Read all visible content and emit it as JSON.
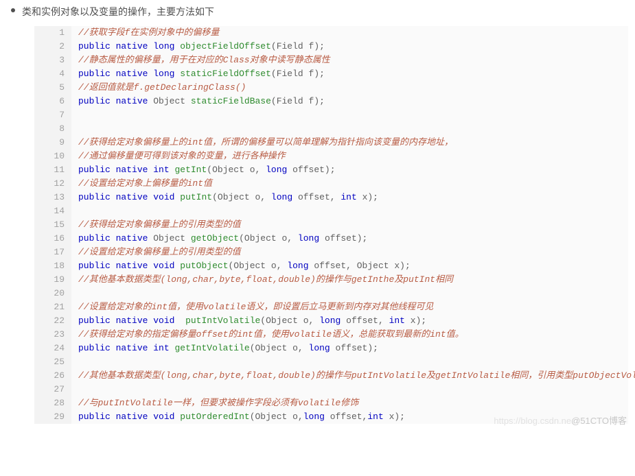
{
  "intro_text": "类和实例对象以及变量的操作，主要方法如下",
  "watermark_left": "https://blog.csdn.ne",
  "watermark_right": "@51CTO博客",
  "code_lines": [
    [
      {
        "t": "//获取字段f在实例对象中的偏移量",
        "c": "comment"
      }
    ],
    [
      {
        "t": "public",
        "c": "keyword"
      },
      {
        "t": " "
      },
      {
        "t": "native",
        "c": "keyword"
      },
      {
        "t": " "
      },
      {
        "t": "long",
        "c": "keyword"
      },
      {
        "t": " "
      },
      {
        "t": "objectFieldOffset",
        "c": "method"
      },
      {
        "t": "(Field f);",
        "c": "ident"
      }
    ],
    [
      {
        "t": "//静态属性的偏移量，用于在对应的Class对象中读写静态属性",
        "c": "comment"
      }
    ],
    [
      {
        "t": "public",
        "c": "keyword"
      },
      {
        "t": " "
      },
      {
        "t": "native",
        "c": "keyword"
      },
      {
        "t": " "
      },
      {
        "t": "long",
        "c": "keyword"
      },
      {
        "t": " "
      },
      {
        "t": "staticFieldOffset",
        "c": "method"
      },
      {
        "t": "(Field f);",
        "c": "ident"
      }
    ],
    [
      {
        "t": "//返回值就是f.getDeclaringClass()",
        "c": "comment"
      }
    ],
    [
      {
        "t": "public",
        "c": "keyword"
      },
      {
        "t": " "
      },
      {
        "t": "native",
        "c": "keyword"
      },
      {
        "t": " "
      },
      {
        "t": "Object",
        "c": "type"
      },
      {
        "t": " "
      },
      {
        "t": "staticFieldBase",
        "c": "method"
      },
      {
        "t": "(Field f);",
        "c": "ident"
      }
    ],
    [],
    [],
    [
      {
        "t": "//获得给定对象偏移量上的int值，所谓的偏移量可以简单理解为指针指向该变量的内存地址，",
        "c": "comment"
      }
    ],
    [
      {
        "t": "//通过偏移量便可得到该对象的变量，进行各种操作",
        "c": "comment"
      }
    ],
    [
      {
        "t": "public",
        "c": "keyword"
      },
      {
        "t": " "
      },
      {
        "t": "native",
        "c": "keyword"
      },
      {
        "t": " "
      },
      {
        "t": "int",
        "c": "keyword"
      },
      {
        "t": " "
      },
      {
        "t": "getInt",
        "c": "method"
      },
      {
        "t": "(Object o, ",
        "c": "ident"
      },
      {
        "t": "long",
        "c": "keyword"
      },
      {
        "t": " offset);",
        "c": "ident"
      }
    ],
    [
      {
        "t": "//设置给定对象上偏移量的int值",
        "c": "comment"
      }
    ],
    [
      {
        "t": "public",
        "c": "keyword"
      },
      {
        "t": " "
      },
      {
        "t": "native",
        "c": "keyword"
      },
      {
        "t": " "
      },
      {
        "t": "void",
        "c": "keyword"
      },
      {
        "t": " "
      },
      {
        "t": "putInt",
        "c": "method"
      },
      {
        "t": "(Object o, ",
        "c": "ident"
      },
      {
        "t": "long",
        "c": "keyword"
      },
      {
        "t": " offset, ",
        "c": "ident"
      },
      {
        "t": "int",
        "c": "keyword"
      },
      {
        "t": " x);",
        "c": "ident"
      }
    ],
    [],
    [
      {
        "t": "//获得给定对象偏移量上的引用类型的值",
        "c": "comment"
      }
    ],
    [
      {
        "t": "public",
        "c": "keyword"
      },
      {
        "t": " "
      },
      {
        "t": "native",
        "c": "keyword"
      },
      {
        "t": " "
      },
      {
        "t": "Object",
        "c": "type"
      },
      {
        "t": " "
      },
      {
        "t": "getObject",
        "c": "method"
      },
      {
        "t": "(Object o, ",
        "c": "ident"
      },
      {
        "t": "long",
        "c": "keyword"
      },
      {
        "t": " offset);",
        "c": "ident"
      }
    ],
    [
      {
        "t": "//设置给定对象偏移量上的引用类型的值",
        "c": "comment"
      }
    ],
    [
      {
        "t": "public",
        "c": "keyword"
      },
      {
        "t": " "
      },
      {
        "t": "native",
        "c": "keyword"
      },
      {
        "t": " "
      },
      {
        "t": "void",
        "c": "keyword"
      },
      {
        "t": " "
      },
      {
        "t": "putObject",
        "c": "method"
      },
      {
        "t": "(Object o, ",
        "c": "ident"
      },
      {
        "t": "long",
        "c": "keyword"
      },
      {
        "t": " offset, Object x);",
        "c": "ident"
      }
    ],
    [
      {
        "t": "//其他基本数据类型(long,char,byte,float,double)的操作与getInthe及putInt相同",
        "c": "comment"
      }
    ],
    [],
    [
      {
        "t": "//设置给定对象的int值，使用volatile语义，即设置后立马更新到内存对其他线程可见",
        "c": "comment"
      }
    ],
    [
      {
        "t": "public",
        "c": "keyword"
      },
      {
        "t": " "
      },
      {
        "t": "native",
        "c": "keyword"
      },
      {
        "t": " "
      },
      {
        "t": "void",
        "c": "keyword"
      },
      {
        "t": "  "
      },
      {
        "t": "putIntVolatile",
        "c": "method"
      },
      {
        "t": "(Object o, ",
        "c": "ident"
      },
      {
        "t": "long",
        "c": "keyword"
      },
      {
        "t": " offset, ",
        "c": "ident"
      },
      {
        "t": "int",
        "c": "keyword"
      },
      {
        "t": " x);",
        "c": "ident"
      }
    ],
    [
      {
        "t": "//获得给定对象的指定偏移量offset的int值，使用volatile语义，总能获取到最新的int值。",
        "c": "comment"
      }
    ],
    [
      {
        "t": "public",
        "c": "keyword"
      },
      {
        "t": " "
      },
      {
        "t": "native",
        "c": "keyword"
      },
      {
        "t": " "
      },
      {
        "t": "int",
        "c": "keyword"
      },
      {
        "t": " "
      },
      {
        "t": "getIntVolatile",
        "c": "method"
      },
      {
        "t": "(Object o, ",
        "c": "ident"
      },
      {
        "t": "long",
        "c": "keyword"
      },
      {
        "t": " offset);",
        "c": "ident"
      }
    ],
    [],
    [
      {
        "t": "//其他基本数据类型(long,char,byte,float,double)的操作与putIntVolatile及getIntVolatile相同，引用类型putObjectVolatile也一样。",
        "c": "comment"
      }
    ],
    [],
    [
      {
        "t": "//与putIntVolatile一样，但要求被操作字段必须有volatile修饰",
        "c": "comment"
      }
    ],
    [
      {
        "t": "public",
        "c": "keyword"
      },
      {
        "t": " "
      },
      {
        "t": "native",
        "c": "keyword"
      },
      {
        "t": " "
      },
      {
        "t": "void",
        "c": "keyword"
      },
      {
        "t": " "
      },
      {
        "t": "putOrderedInt",
        "c": "method"
      },
      {
        "t": "(Object o,",
        "c": "ident"
      },
      {
        "t": "long",
        "c": "keyword"
      },
      {
        "t": " offset,",
        "c": "ident"
      },
      {
        "t": "int",
        "c": "keyword"
      },
      {
        "t": " x);",
        "c": "ident"
      }
    ]
  ]
}
